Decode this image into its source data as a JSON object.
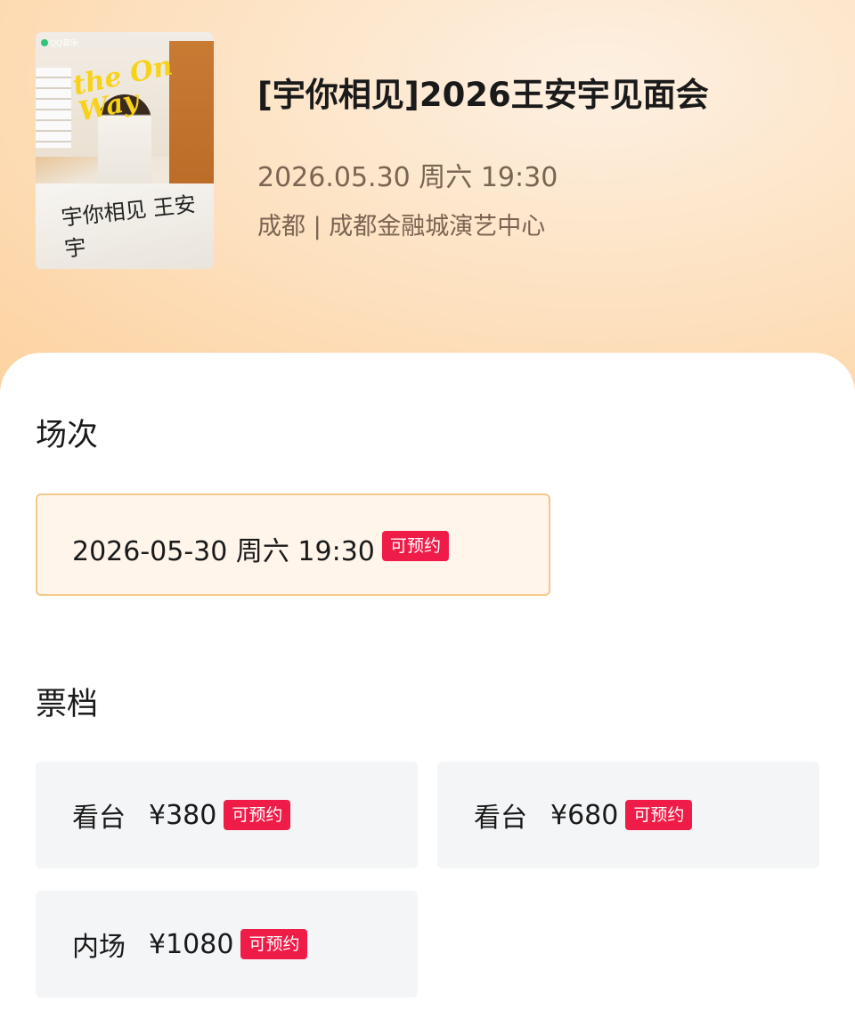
{
  "event": {
    "poster": {
      "logo_text": "QQ音乐",
      "scribble_text": "the On Way",
      "handwritten_text": "宇你相见 王安宇"
    },
    "title": "[宇你相见]2026王安宇见面会",
    "datetime": "2026.05.30 周六 19:30",
    "venue": "成都 | 成都金融城演艺中心"
  },
  "sessions": {
    "heading": "场次",
    "items": [
      {
        "label": "2026-05-30 周六 19:30",
        "status": "可预约"
      }
    ]
  },
  "tickets": {
    "heading": "票档",
    "items": [
      {
        "label": "看台",
        "price": "¥380",
        "status": "可预约"
      },
      {
        "label": "看台",
        "price": "¥680",
        "status": "可预约"
      },
      {
        "label": "内场",
        "price": "¥1080",
        "status": "可预约"
      }
    ]
  },
  "colors": {
    "badge": "#ef1c48",
    "selected_border": "#f3c98a",
    "selected_bg": "#fff5ea",
    "card_bg": "#f4f5f7"
  }
}
